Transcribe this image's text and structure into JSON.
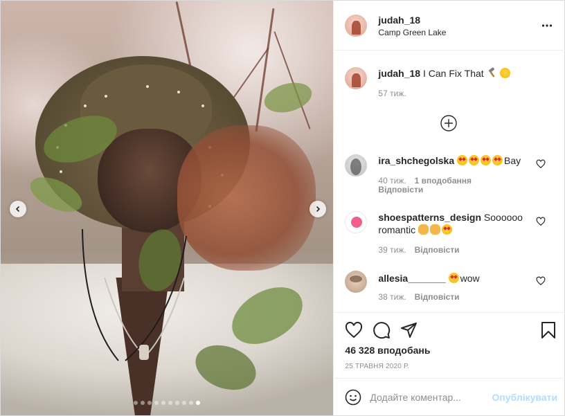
{
  "header": {
    "username": "judah_18",
    "location": "Camp Green Lake"
  },
  "caption": {
    "username": "judah_18",
    "text": "I Can Fix That",
    "emojis": [
      "hammer-emoji",
      "smirk-emoji"
    ],
    "time": "57 тиж."
  },
  "comments": [
    {
      "username": "ira_shchegolska",
      "text": "Bay",
      "emojis_before_text": 4,
      "time": "40 тиж.",
      "likes": "1 вподобання",
      "reply": "Відповісти"
    },
    {
      "username": "shoespatterns_design",
      "text": "Soooooo romantic",
      "time": "39 тиж.",
      "reply": "Відповісти"
    },
    {
      "username": "allesia_______",
      "text": "wow",
      "time": "38 тиж.",
      "reply": "Відповісти"
    }
  ],
  "stats": {
    "likes": "46 328 вподобань",
    "date": "25 травня 2020 р."
  },
  "add_comment": {
    "placeholder": "Додайте коментар...",
    "post_label": "Опублікувати"
  },
  "carousel": {
    "total_slides": 10,
    "active_index": 9
  },
  "colors": {
    "post_button_disabled": "#b3dbff",
    "muted_text": "#8e8e8e",
    "border": "#efefef"
  }
}
